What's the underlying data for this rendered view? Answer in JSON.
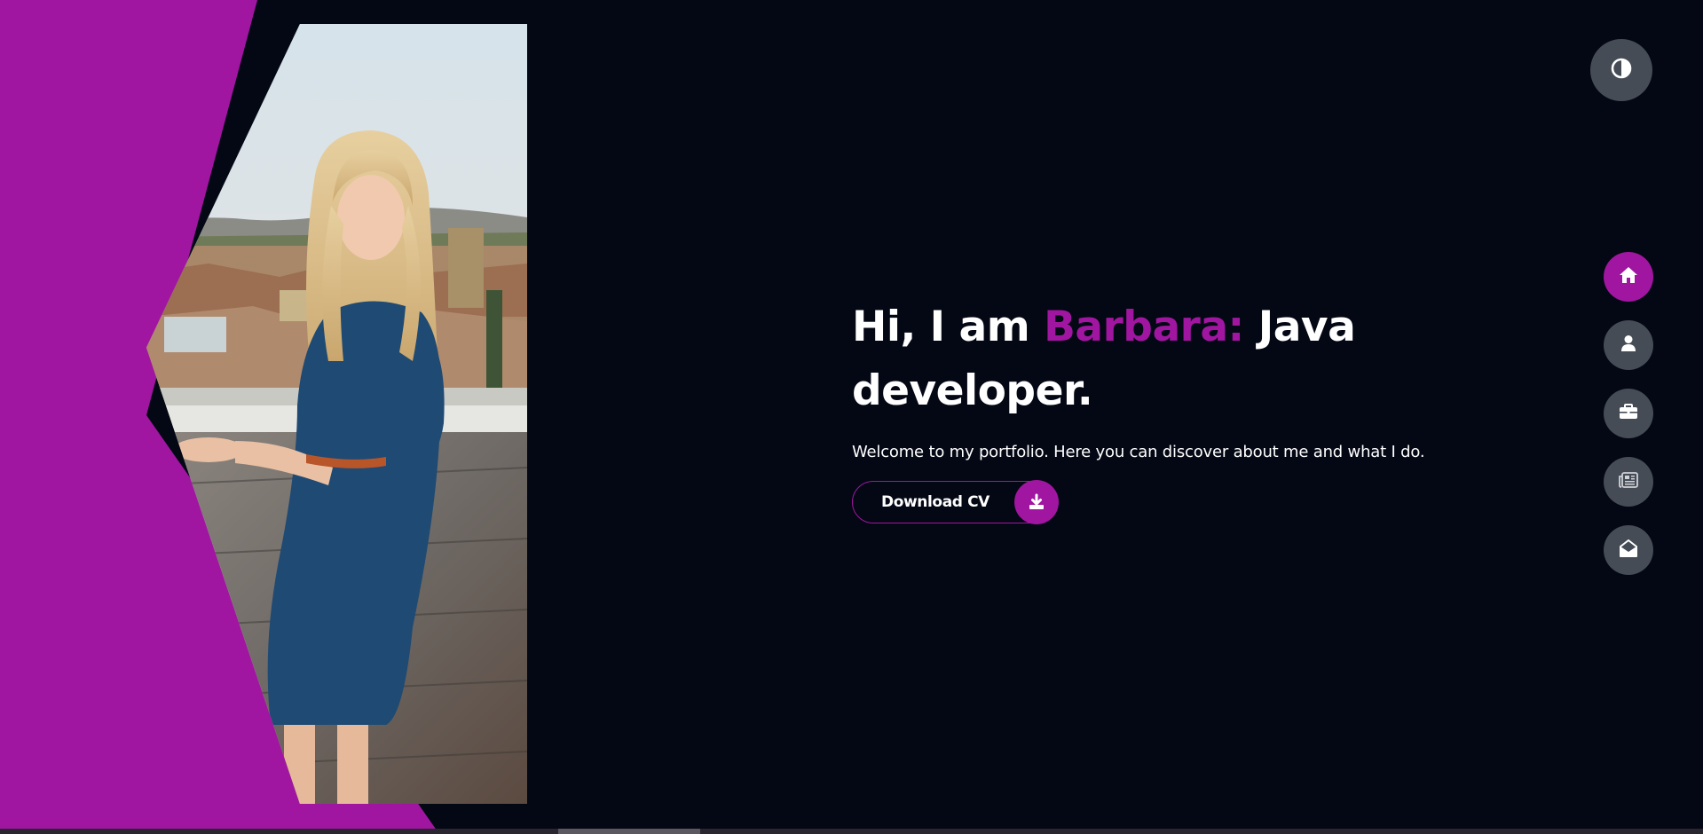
{
  "hero": {
    "title_prefix": "Hi, I am ",
    "title_name": "Barbara:",
    "title_suffix": " Java developer.",
    "subtitle": "Welcome to my portfolio. Here you can discover about me and what I do.",
    "download_label": "Download CV"
  },
  "icons": {
    "theme": "contrast-icon",
    "download": "download-icon",
    "nav": [
      "home-icon",
      "user-icon",
      "briefcase-icon",
      "newspaper-icon",
      "envelope-open-icon"
    ]
  },
  "colors": {
    "background": "#040714",
    "accent": "#a016a0",
    "nav_button": "#454c56",
    "text": "#ffffff"
  },
  "nav": {
    "active_index": 0
  }
}
